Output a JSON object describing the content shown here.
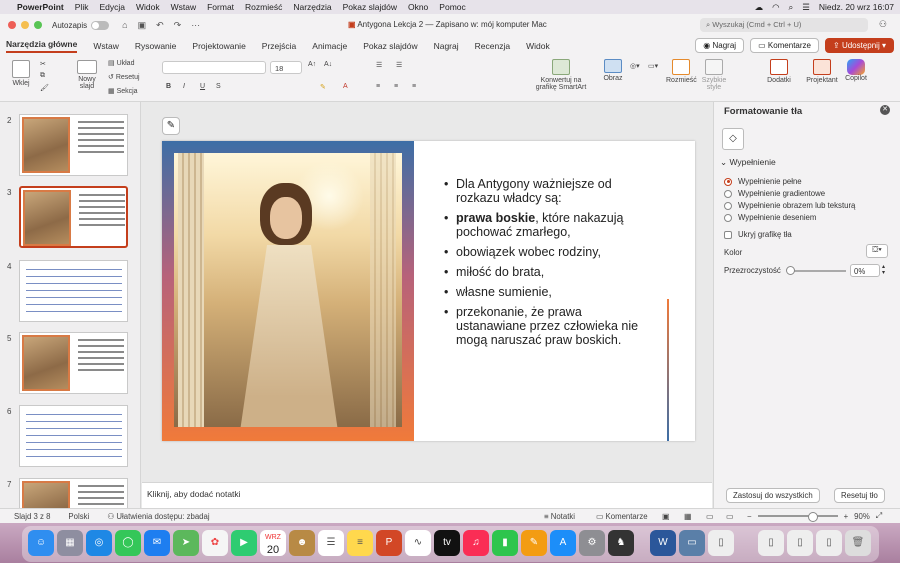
{
  "menubar": {
    "app": "PowerPoint",
    "items": [
      "Plik",
      "Edycja",
      "Widok",
      "Wstaw",
      "Format",
      "Rozmieść",
      "Narzędzia",
      "Pokaz slajdów",
      "Okno",
      "Pomoc"
    ],
    "clock": "Niedz. 20 wrz  16:07"
  },
  "titlebar": {
    "autosave_label": "Autozapis",
    "doc_title": "Antygona Lekcja 2",
    "save_status": "— Zapisano w: mój komputer Mac",
    "search_placeholder": "Wyszukaj (Cmd + Ctrl + U)"
  },
  "tabs": [
    "Narzędzia główne",
    "Wstaw",
    "Rysowanie",
    "Projektowanie",
    "Przejścia",
    "Animacje",
    "Pokaz slajdów",
    "Nagraj",
    "Recenzja",
    "Widok"
  ],
  "tab_buttons": {
    "record": "Nagraj",
    "comments": "Komentarze",
    "share": "Udostępnij"
  },
  "ribbon": {
    "paste": "Wklej",
    "new_slide": "Nowy slajd",
    "layout": "Układ",
    "reset": "Resetuj",
    "section": "Sekcja",
    "font_size": "18",
    "smartart": "Konwertuj na grafikę SmartArt",
    "picture": "Obraz",
    "arrange": "Rozmieść",
    "quick_styles": "Szybkie style",
    "addins": "Dodatki",
    "designer": "Projektant",
    "copilot": "Copilot"
  },
  "thumbnails": [
    {
      "num": "2",
      "kind": "image-text"
    },
    {
      "num": "3",
      "kind": "image-text",
      "selected": true
    },
    {
      "num": "4",
      "kind": "table"
    },
    {
      "num": "5",
      "kind": "image-text"
    },
    {
      "num": "6",
      "kind": "table"
    },
    {
      "num": "7",
      "kind": "image-text"
    }
  ],
  "slide": {
    "bullets": [
      {
        "bold": "",
        "text": "Dla Antygony ważniejsze od rozkazu władcy są:"
      },
      {
        "bold": "prawa boskie",
        "text": ", które nakazują pochować zmarłego,"
      },
      {
        "bold": "",
        "text": "obowiązek wobec rodziny,"
      },
      {
        "bold": "",
        "text": "miłość do brata,"
      },
      {
        "bold": "",
        "text": "własne sumienie,"
      },
      {
        "bold": "",
        "text": "przekonanie, że prawa ustanawiane przez człowieka nie mogą naruszać praw boskich."
      }
    ]
  },
  "notes_placeholder": "Kliknij, aby dodać notatki",
  "pane": {
    "title": "Formatowanie tła",
    "section": "Wypełnienie",
    "options": [
      "Wypełnienie pełne",
      "Wypełnienie gradientowe",
      "Wypełnienie obrazem lub teksturą",
      "Wypełnienie deseniem"
    ],
    "selected_option": "Wypełnienie pełne",
    "hide_graphics": "Ukryj grafikę tła",
    "color_label": "Kolor",
    "transparency_label": "Przezroczystość",
    "transparency_value": "0%",
    "apply_all": "Zastosuj do wszystkich",
    "reset_bg": "Resetuj tło"
  },
  "statusbar": {
    "slide_info": "Slajd 3 z 8",
    "language": "Polski",
    "accessibility": "Ułatwienia dostępu: zbadaj",
    "notes": "Notatki",
    "comments": "Komentarze",
    "zoom": "90%"
  },
  "dock": {
    "calendar_month": "WRZ",
    "calendar_day": "20"
  },
  "colors": {
    "accent": "#c43e1c",
    "frame_top": "#3d6ea6",
    "frame_bottom": "#f07a3a"
  }
}
